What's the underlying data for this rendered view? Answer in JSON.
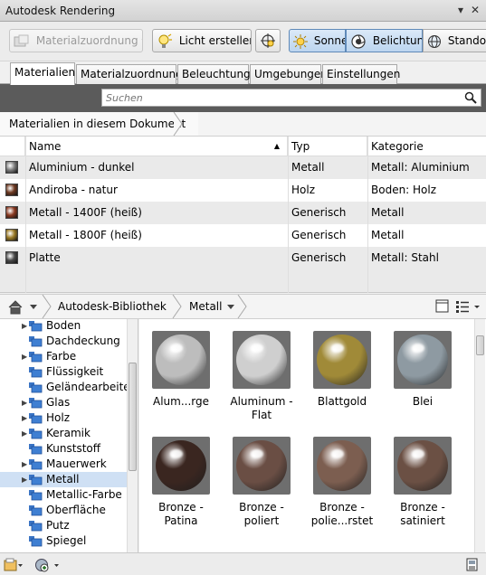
{
  "window": {
    "title": "Autodesk Rendering"
  },
  "toolbar": {
    "material_assign": "Materialzuordnung",
    "light_create": "Licht erstellen",
    "sun": "Sonne",
    "exposure": "Belichtung",
    "location": "Standort"
  },
  "tabs": [
    "Materialien",
    "Materialzuordnung",
    "Beleuchtung",
    "Umgebungen",
    "Einstellungen"
  ],
  "search": {
    "placeholder": "Suchen"
  },
  "document_panel": {
    "breadcrumb": "Materialien in diesem Dokument",
    "columns": {
      "name": "Name",
      "type": "Typ",
      "category": "Kategorie"
    },
    "rows": [
      {
        "name": "Aluminium - dunkel",
        "type": "Metall",
        "category": "Metall: Aluminium",
        "swatch": "#7d7d7d"
      },
      {
        "name": "Andiroba - natur",
        "type": "Holz",
        "category": "Boden: Holz",
        "swatch": "#6e3a22"
      },
      {
        "name": "Metall - 1400F (heiß)",
        "type": "Generisch",
        "category": "Metall",
        "swatch": "#8a3a22"
      },
      {
        "name": "Metall - 1800F (heiß)",
        "type": "Generisch",
        "category": "Metall",
        "swatch": "#9a7a26"
      },
      {
        "name": "Platte",
        "type": "Generisch",
        "category": "Metall: Stahl",
        "swatch": "#4a4a4a"
      }
    ]
  },
  "library_panel": {
    "breadcrumb": [
      "Autodesk-Bibliothek",
      "Metall"
    ],
    "tree": [
      {
        "label": "Boden",
        "expandable": true
      },
      {
        "label": "Dachdeckung",
        "expandable": false
      },
      {
        "label": "Farbe",
        "expandable": true
      },
      {
        "label": "Flüssigkeit",
        "expandable": false
      },
      {
        "label": "Geländearbeiten",
        "expandable": false
      },
      {
        "label": "Glas",
        "expandable": true
      },
      {
        "label": "Holz",
        "expandable": true
      },
      {
        "label": "Keramik",
        "expandable": true
      },
      {
        "label": "Kunststoff",
        "expandable": false
      },
      {
        "label": "Mauerwerk",
        "expandable": true
      },
      {
        "label": "Metall",
        "expandable": true,
        "selected": true
      },
      {
        "label": "Metallic-Farbe",
        "expandable": false
      },
      {
        "label": "Oberfläche",
        "expandable": false
      },
      {
        "label": "Putz",
        "expandable": false
      },
      {
        "label": "Spiegel",
        "expandable": false
      }
    ],
    "materials": [
      {
        "name": "Alum...rge",
        "color": "#bdbdbd"
      },
      {
        "name": "Aluminum - Flat",
        "color": "#cfcfcf"
      },
      {
        "name": "Blattgold",
        "color": "#a08a38"
      },
      {
        "name": "Blei",
        "color": "#8e9aa2"
      },
      {
        "name": "Bronze - Patina",
        "color": "#3a2620"
      },
      {
        "name": "Bronze - poliert",
        "color": "#6a4e44"
      },
      {
        "name": "Bronze - polie...rstet",
        "color": "#7c5e50"
      },
      {
        "name": "Bronze - satiniert",
        "color": "#6b5044"
      }
    ]
  }
}
